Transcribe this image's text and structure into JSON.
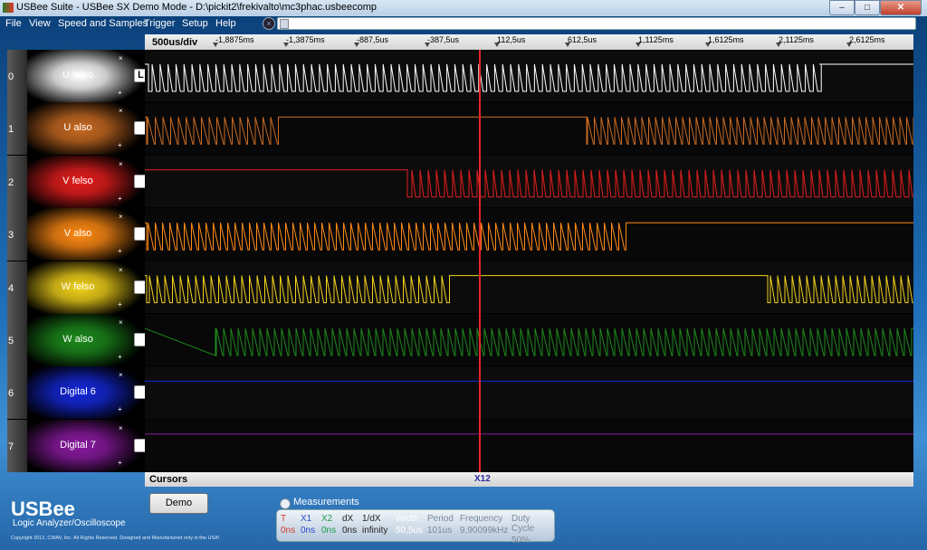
{
  "window": {
    "title": "USBee Suite - USBee SX Demo Mode - D:\\pickit2\\frekivalto\\mc3phac.usbeecomp",
    "minimize": "–",
    "maximize": "□",
    "close": "✕"
  },
  "menu": [
    "File",
    "View",
    "Speed and Samples",
    "Trigger",
    "Setup",
    "Help"
  ],
  "cancel_icon": "×",
  "timebar": {
    "div": "500us/div",
    "ticks": [
      "-1,8875ms",
      "-1,3875ms",
      "-887,5us",
      "-387,5us",
      "112,5us",
      "612,5us",
      "1,1125ms",
      "1,6125ms",
      "2,1125ms",
      "2,6125ms"
    ]
  },
  "channels": [
    {
      "num": "0",
      "label": "U felso",
      "color": "#ffffff",
      "checkbox": "L"
    },
    {
      "num": "1",
      "label": "U also",
      "color": "#c86a22",
      "checkbox": ""
    },
    {
      "num": "2",
      "label": "V felso",
      "color": "#e61e1e",
      "checkbox": ""
    },
    {
      "num": "3",
      "label": "V also",
      "color": "#ff8a14",
      "checkbox": ""
    },
    {
      "num": "4",
      "label": "W felso",
      "color": "#f2d21a",
      "checkbox": ""
    },
    {
      "num": "5",
      "label": "W also",
      "color": "#1c8a1c",
      "checkbox": ""
    },
    {
      "num": "6",
      "label": "Digital 6",
      "color": "#1428d8",
      "checkbox": ""
    },
    {
      "num": "7",
      "label": "Digital 7",
      "color": "#8a1aa0",
      "checkbox": ""
    }
  ],
  "channel_x": "×",
  "channel_plus": "+",
  "cursors": {
    "label": "Cursors",
    "marker": "X12"
  },
  "logo": {
    "name": "USBee",
    "subtitle": "Logic Analyzer/Oscilloscope",
    "copyright": "Copyright 2012, CWAV, Inc. All Rights Reserved. Designed and Manufactured only in the USA!"
  },
  "demo_button": "Demo",
  "measurements": {
    "title": "Measurements",
    "columns": [
      {
        "h": "T",
        "v": "0ns",
        "hc": "#d23a2a",
        "vc": "#d23a2a"
      },
      {
        "h": "X1",
        "v": "0ns",
        "hc": "#2a4ac8",
        "vc": "#2a4ac8"
      },
      {
        "h": "X2",
        "v": "0ns",
        "hc": "#1e9a4a",
        "vc": "#1e9a4a"
      },
      {
        "h": "dX",
        "v": "0ns",
        "hc": "#222222",
        "vc": "#222222"
      },
      {
        "h": "1/dX",
        "v": "infinity",
        "hc": "#222222",
        "vc": "#222222"
      },
      {
        "h": "Width",
        "v": "50,5us",
        "hc": "#ffffff",
        "vc": "#ffffff"
      },
      {
        "h": "Period",
        "v": "101us",
        "hc": "#7a8899",
        "vc": "#7a8899"
      },
      {
        "h": "Frequency",
        "v": "9,90099kHz",
        "hc": "#7a8899",
        "vc": "#7a8899"
      },
      {
        "h": "Duty Cycle",
        "v": "50%",
        "hc": "#7a8899",
        "vc": "#7a8899"
      }
    ]
  }
}
